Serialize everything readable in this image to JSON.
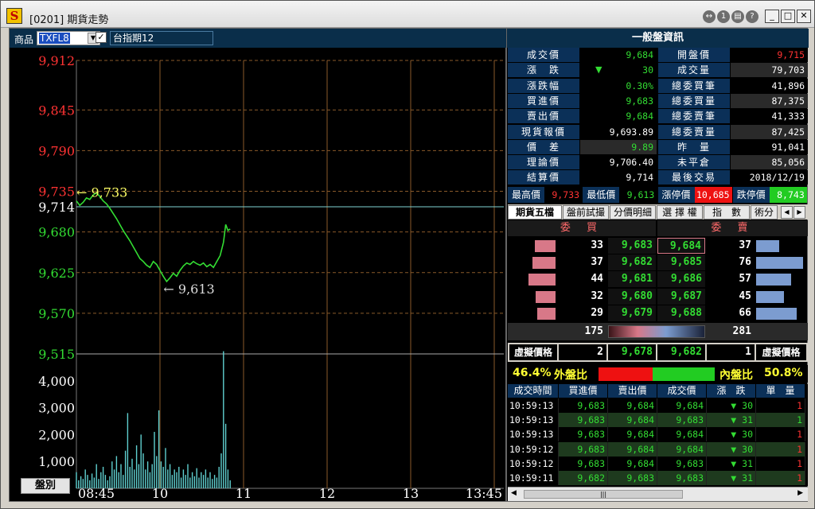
{
  "window": {
    "title": "[0201] 期貨走勢",
    "app_icon": "S"
  },
  "product": {
    "label": "商品",
    "code": "TXFL8",
    "name": "台指期12",
    "checked": true
  },
  "period_button": "盤別",
  "chart_data": {
    "type": "line",
    "price_axis": {
      "ticks_upper": [
        "9,912",
        "9,845",
        "9,790",
        "9,735"
      ],
      "ref": "9,714",
      "ticks_lower": [
        "9,680",
        "9,625",
        "9,570",
        "9,515"
      ],
      "ylim": [
        9515,
        9912
      ]
    },
    "volume_axis": {
      "ticks": [
        "4,000",
        "3,000",
        "2,000",
        "1,000"
      ],
      "ylim": [
        0,
        5000
      ]
    },
    "x_ticks": [
      "08:45",
      "10",
      "11",
      "12",
      "13",
      "13:45"
    ],
    "reference_price": 9714,
    "high_annotation": "← 9,733",
    "low_annotation": "← 9,613",
    "price_series": [
      [
        0,
        9722
      ],
      [
        3,
        9716
      ],
      [
        6,
        9720
      ],
      [
        9,
        9726
      ],
      [
        12,
        9724
      ],
      [
        15,
        9730
      ],
      [
        18,
        9733
      ],
      [
        21,
        9728
      ],
      [
        24,
        9722
      ],
      [
        27,
        9718
      ],
      [
        30,
        9712
      ],
      [
        33,
        9705
      ],
      [
        36,
        9698
      ],
      [
        39,
        9690
      ],
      [
        42,
        9682
      ],
      [
        45,
        9675
      ],
      [
        48,
        9668
      ],
      [
        51,
        9660
      ],
      [
        54,
        9652
      ],
      [
        57,
        9644
      ],
      [
        60,
        9640
      ],
      [
        63,
        9635
      ],
      [
        66,
        9632
      ],
      [
        69,
        9640
      ],
      [
        72,
        9636
      ],
      [
        75,
        9628
      ],
      [
        78,
        9620
      ],
      [
        81,
        9613
      ],
      [
        84,
        9618
      ],
      [
        87,
        9624
      ],
      [
        90,
        9620
      ],
      [
        93,
        9628
      ],
      [
        96,
        9634
      ],
      [
        99,
        9638
      ],
      [
        102,
        9636
      ],
      [
        105,
        9640
      ],
      [
        108,
        9637
      ],
      [
        111,
        9635
      ],
      [
        114,
        9638
      ],
      [
        117,
        9633
      ],
      [
        120,
        9636
      ],
      [
        123,
        9632
      ],
      [
        126,
        9640
      ],
      [
        129,
        9648
      ],
      [
        132,
        9666
      ],
      [
        134,
        9690
      ],
      [
        136,
        9682
      ],
      [
        138,
        9684
      ]
    ],
    "volume_series": [
      [
        0,
        600
      ],
      [
        2,
        300
      ],
      [
        4,
        450
      ],
      [
        6,
        350
      ],
      [
        8,
        700
      ],
      [
        10,
        500
      ],
      [
        12,
        300
      ],
      [
        14,
        550
      ],
      [
        16,
        400
      ],
      [
        18,
        900
      ],
      [
        20,
        350
      ],
      [
        22,
        600
      ],
      [
        24,
        800
      ],
      [
        26,
        500
      ],
      [
        28,
        300
      ],
      [
        30,
        450
      ],
      [
        32,
        1000
      ],
      [
        34,
        700
      ],
      [
        36,
        1200
      ],
      [
        38,
        600
      ],
      [
        40,
        900
      ],
      [
        42,
        500
      ],
      [
        44,
        1400
      ],
      [
        46,
        2800
      ],
      [
        48,
        800
      ],
      [
        50,
        1100
      ],
      [
        52,
        700
      ],
      [
        54,
        1600
      ],
      [
        56,
        900
      ],
      [
        58,
        2000
      ],
      [
        60,
        1300
      ],
      [
        62,
        700
      ],
      [
        64,
        1000
      ],
      [
        66,
        600
      ],
      [
        68,
        900
      ],
      [
        70,
        2100
      ],
      [
        72,
        1200
      ],
      [
        74,
        2900
      ],
      [
        76,
        1000
      ],
      [
        78,
        800
      ],
      [
        80,
        1500
      ],
      [
        82,
        700
      ],
      [
        84,
        900
      ],
      [
        86,
        500
      ],
      [
        88,
        700
      ],
      [
        90,
        600
      ],
      [
        92,
        800
      ],
      [
        94,
        400
      ],
      [
        96,
        700
      ],
      [
        98,
        500
      ],
      [
        100,
        900
      ],
      [
        102,
        400
      ],
      [
        104,
        600
      ],
      [
        106,
        450
      ],
      [
        108,
        750
      ],
      [
        110,
        400
      ],
      [
        112,
        600
      ],
      [
        114,
        500
      ],
      [
        116,
        700
      ],
      [
        118,
        400
      ],
      [
        120,
        600
      ],
      [
        122,
        350
      ],
      [
        124,
        500
      ],
      [
        126,
        400
      ],
      [
        128,
        800
      ],
      [
        130,
        1300
      ],
      [
        132,
        5100
      ],
      [
        134,
        2400
      ],
      [
        136,
        700
      ],
      [
        138,
        300
      ]
    ]
  },
  "info": {
    "header": "一般盤資訊",
    "rows": [
      {
        "l1": "成交價",
        "v1": "9,684",
        "c1": "#33dd33",
        "l2": "開盤價",
        "v2": "9,715",
        "c2": "#ff3333"
      },
      {
        "l1": "漲　跌",
        "arrow": "▼",
        "v1": "30",
        "c1": "#33dd33",
        "l2": "成交量",
        "v2": "79,703",
        "c2": "#ffffff"
      },
      {
        "l1": "漲跌幅",
        "v1": "0.30%",
        "c1": "#33dd33",
        "l2": "總委買筆",
        "v2": "41,896",
        "c2": "#ffffff"
      },
      {
        "l1": "買進價",
        "v1": "9,683",
        "c1": "#33dd33",
        "l2": "總委買量",
        "v2": "87,375",
        "c2": "#ffffff"
      },
      {
        "l1": "賣出價",
        "v1": "9,684",
        "c1": "#33dd33",
        "l2": "總委賣筆",
        "v2": "41,333",
        "c2": "#ffffff"
      },
      {
        "l1": "現貨報價",
        "v1": "9,693.89",
        "c1": "#ffffff",
        "l2": "總委賣量",
        "v2": "87,425",
        "c2": "#ffffff"
      },
      {
        "l1": "價　差",
        "v1": "9.89",
        "c1": "#33dd33",
        "l2": "昨　量",
        "v2": "91,041",
        "c2": "#ffffff"
      },
      {
        "l1": "理論價",
        "v1": "9,706.40",
        "c1": "#ffffff",
        "l2": "未平倉",
        "v2": "85,056",
        "c2": "#ffffff"
      },
      {
        "l1": "結算價",
        "v1": "9,714",
        "c1": "#ffffff",
        "l2": "最後交易",
        "v2": "2018/12/19",
        "c2": "#ffffff"
      }
    ],
    "limits": [
      {
        "label": "最高價",
        "value": "9,733",
        "color": "#ff3333",
        "bg": "#000"
      },
      {
        "label": "最低價",
        "value": "9,613",
        "color": "#33dd33",
        "bg": "#000"
      },
      {
        "label": "漲停價",
        "value": "10,685",
        "color": "#ffffff",
        "bg": "#ee1111"
      },
      {
        "label": "跌停價",
        "value": "8,743",
        "color": "#ffffff",
        "bg": "#22cc22"
      }
    ]
  },
  "tabs": [
    "期貨五檔",
    "盤前試撮",
    "分價明細",
    "選 擇 權",
    "指　數",
    "術分"
  ],
  "orderbook": {
    "bid_header": "委 買",
    "ask_header": "委 賣",
    "rows": [
      {
        "bidq": "33",
        "bid": "9,683",
        "ask": "9,684",
        "askq": "37",
        "bidw": 0.33,
        "askw": 0.37
      },
      {
        "bidq": "37",
        "bid": "9,682",
        "ask": "9,685",
        "askq": "76",
        "bidw": 0.37,
        "askw": 0.76
      },
      {
        "bidq": "44",
        "bid": "9,681",
        "ask": "9,686",
        "askq": "57",
        "bidw": 0.44,
        "askw": 0.57
      },
      {
        "bidq": "32",
        "bid": "9,680",
        "ask": "9,687",
        "askq": "45",
        "bidw": 0.32,
        "askw": 0.45
      },
      {
        "bidq": "29",
        "bid": "9,679",
        "ask": "9,688",
        "askq": "66",
        "bidw": 0.29,
        "askw": 0.66
      }
    ],
    "bid_total": "175",
    "ask_total": "281",
    "virtual": {
      "label_left": "虛擬價格",
      "bidq": "2",
      "bid": "9,678",
      "ask": "9,682",
      "askq": "1",
      "label_right": "虛擬價格"
    }
  },
  "ratio": {
    "left_pct": "46.4%",
    "left_label": "外盤比",
    "right_label": "內盤比",
    "right_pct": "50.8%",
    "outside_share": 0.464
  },
  "ticks": {
    "headers": [
      "成交時間",
      "買進價",
      "賣出價",
      "成交價",
      "漲　跌",
      "單　量"
    ],
    "rows": [
      {
        "t": "10:59:13",
        "b": "9,683",
        "a": "9,684",
        "p": "9,684",
        "pc": "#33dd33",
        "d": "▼ 30",
        "q": "1",
        "qc": "#ff3333"
      },
      {
        "t": "10:59:13",
        "b": "9,683",
        "a": "9,684",
        "p": "9,683",
        "pc": "#33dd33",
        "d": "▼ 31",
        "q": "1",
        "qc": "#33dd33"
      },
      {
        "t": "10:59:13",
        "b": "9,683",
        "a": "9,684",
        "p": "9,684",
        "pc": "#33dd33",
        "d": "▼ 30",
        "q": "1",
        "qc": "#ff3333"
      },
      {
        "t": "10:59:12",
        "b": "9,683",
        "a": "9,684",
        "p": "9,684",
        "pc": "#33dd33",
        "d": "▼ 30",
        "q": "1",
        "qc": "#ff3333"
      },
      {
        "t": "10:59:12",
        "b": "9,683",
        "a": "9,684",
        "p": "9,683",
        "pc": "#33dd33",
        "d": "▼ 31",
        "q": "1",
        "qc": "#ff3333"
      },
      {
        "t": "10:59:11",
        "b": "9,682",
        "a": "9,683",
        "p": "9,683",
        "pc": "#33dd33",
        "d": "▼ 31",
        "q": "1",
        "qc": "#ff3333"
      }
    ]
  },
  "colors": {
    "up": "#ff3333",
    "down": "#33dd33",
    "panel": "#0b3058"
  }
}
